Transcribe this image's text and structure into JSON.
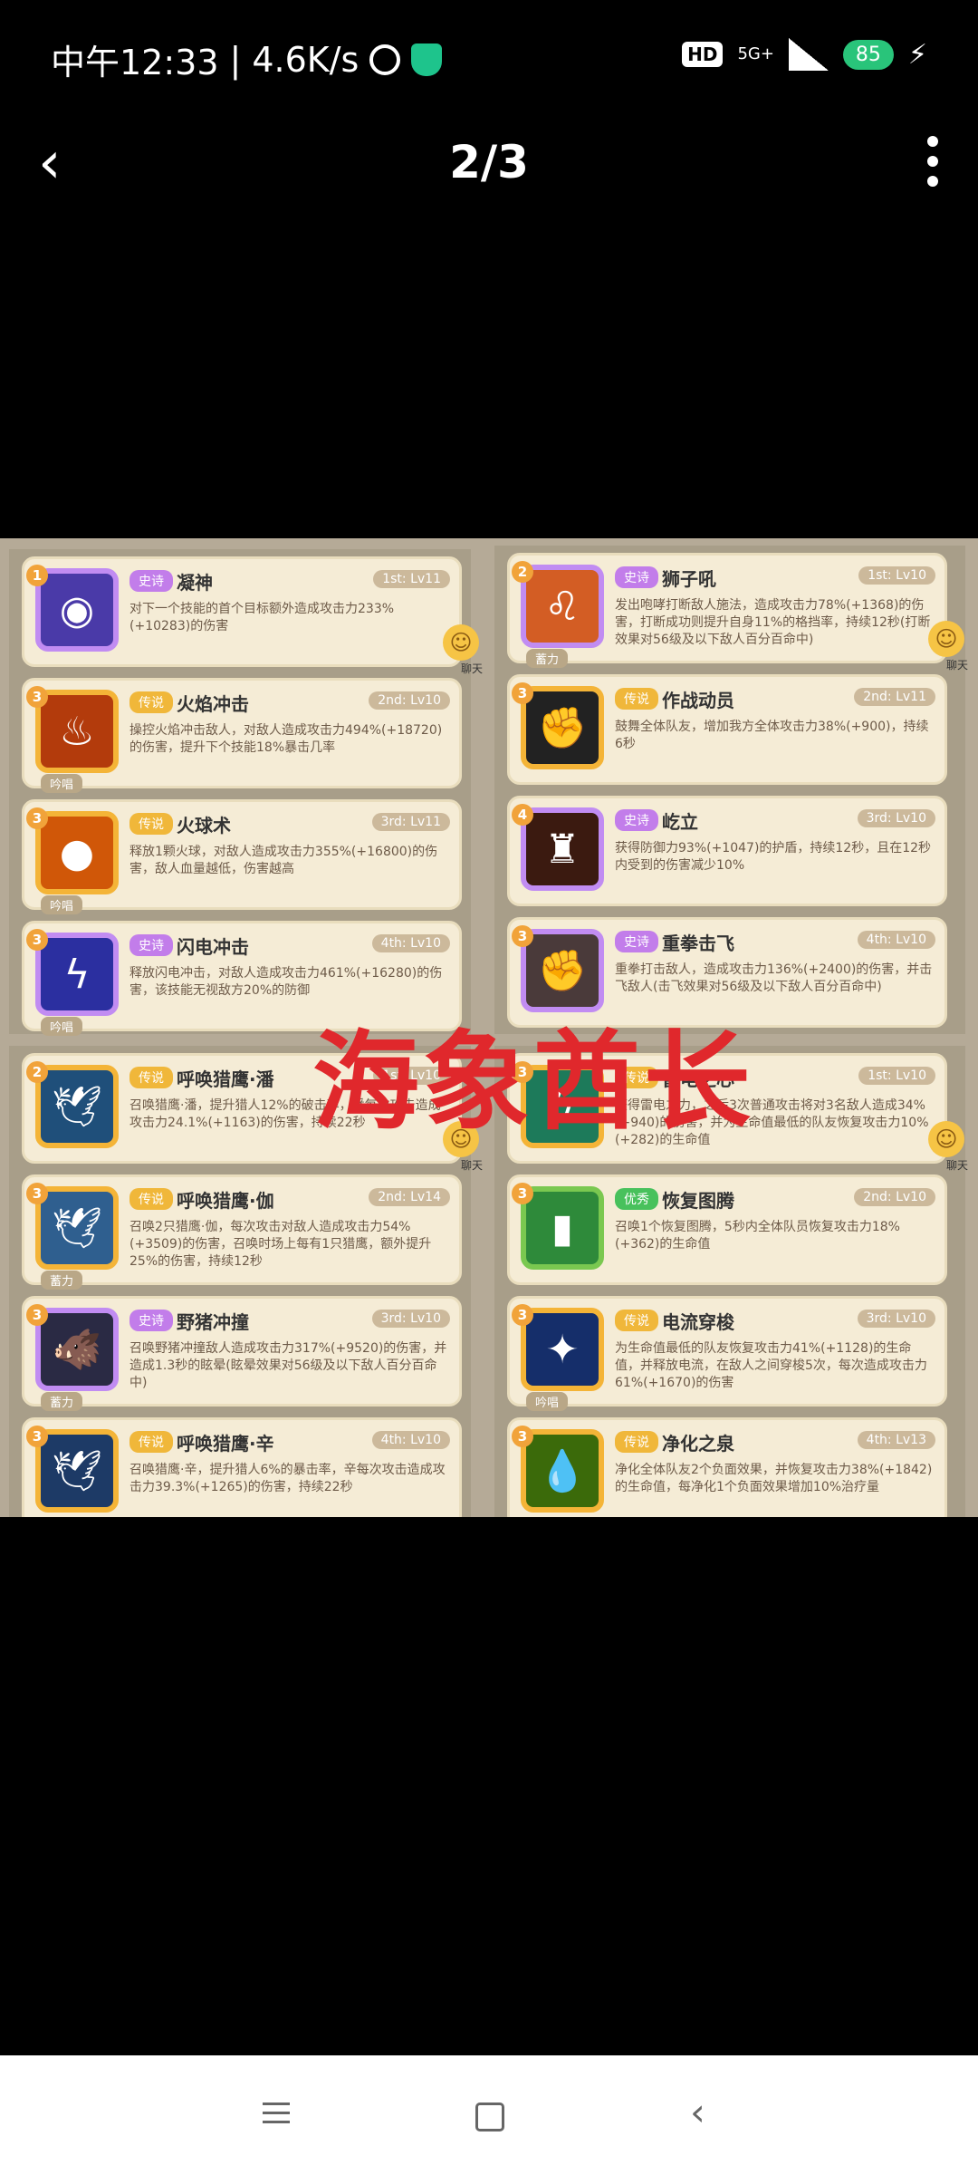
{
  "status_bar": {
    "time": "中午12:33",
    "speed": "4.6K/s",
    "hd": "HD",
    "network": "5G+",
    "battery": "85"
  },
  "header": {
    "counter": "2/3"
  },
  "watermark": "海象酋长",
  "panels": {
    "top_left": [
      {
        "num": "1",
        "rarity": "史诗",
        "rarity_type": "epic",
        "name": "凝神",
        "level": "1st: Lv11",
        "desc": "对下一个技能的首个目标额外造成攻击力233%(+10283)的伤害",
        "tag": "",
        "icon": "eye-icon",
        "chat": "聊天"
      },
      {
        "num": "3",
        "rarity": "传说",
        "rarity_type": "leg",
        "name": "火焰冲击",
        "level": "2nd: Lv10",
        "desc": "操控火焰冲击敌人，对敌人造成攻击力494%(+18720)的伤害，提升下个技能18%暴击几率",
        "tag": "吟唱",
        "icon": "fire-icon"
      },
      {
        "num": "3",
        "rarity": "传说",
        "rarity_type": "leg",
        "name": "火球术",
        "level": "3rd: Lv11",
        "desc": "释放1颗火球，对敌人造成攻击力355%(+16800)的伤害，敌人血量越低，伤害越高",
        "tag": "吟唱",
        "icon": "fireball-icon"
      },
      {
        "num": "3",
        "rarity": "史诗",
        "rarity_type": "epic",
        "name": "闪电冲击",
        "level": "4th: Lv10",
        "desc": "释放闪电冲击，对敌人造成攻击力461%(+16280)的伤害，该技能无视敌方20%的防御",
        "tag": "吟唱",
        "icon": "lightning-icon"
      }
    ],
    "top_right": [
      {
        "num": "2",
        "rarity": "史诗",
        "rarity_type": "epic",
        "name": "狮子吼",
        "level": "1st: Lv10",
        "desc": "发出咆哮打断敌人施法，造成攻击力78%(+1368)的伤害，打断成功则提升自身11%的格挡率，持续12秒(打断效果对56级及以下敌人百分百命中)",
        "tag": "蓄力",
        "icon": "lion-icon",
        "chat": "聊天"
      },
      {
        "num": "3",
        "rarity": "传说",
        "rarity_type": "leg",
        "name": "作战动员",
        "level": "2nd: Lv11",
        "desc": "鼓舞全体队友，增加我方全体攻击力38%(+900)，持续6秒",
        "tag": "",
        "icon": "rally-icon"
      },
      {
        "num": "4",
        "rarity": "史诗",
        "rarity_type": "epic",
        "name": "屹立",
        "level": "3rd: Lv10",
        "desc": "获得防御力93%(+1047)的护盾，持续12秒，且在12秒内受到的伤害减少10%",
        "tag": "",
        "icon": "stand-icon"
      },
      {
        "num": "3",
        "rarity": "史诗",
        "rarity_type": "epic",
        "name": "重拳击飞",
        "level": "4th: Lv10",
        "desc": "重拳打击敌人，造成攻击力136%(+2400)的伤害，并击飞敌人(击飞效果对56级及以下敌人百分百命中)",
        "tag": "",
        "icon": "fist-icon"
      }
    ],
    "bottom_left": [
      {
        "num": "2",
        "rarity": "传说",
        "rarity_type": "leg",
        "name": "呼唤猎鹰·潘",
        "level": "1st: Lv10",
        "desc": "召唤猎鹰·潘，提升猎人12%的破击率，潘每次攻击造成攻击力24.1%(+1163)的伤害，持续22秒",
        "tag": "",
        "icon": "falcon-icon",
        "chat": "聊天"
      },
      {
        "num": "3",
        "rarity": "传说",
        "rarity_type": "leg",
        "name": "呼唤猎鹰·伽",
        "level": "2nd: Lv14",
        "desc": "召唤2只猎鹰·伽，每次攻击对敌人造成攻击力54%(+3509)的伤害，召唤时场上每有1只猎鹰，额外提升25%的伤害，持续12秒",
        "tag": "蓄力",
        "icon": "eagle-icon"
      },
      {
        "num": "3",
        "rarity": "史诗",
        "rarity_type": "epic",
        "name": "野猪冲撞",
        "level": "3rd: Lv10",
        "desc": "召唤野猪冲撞敌人造成攻击力317%(+9520)的伤害，并造成1.3秒的眩晕(眩晕效果对56级及以下敌人百分百命中)",
        "tag": "蓄力",
        "icon": "boar-icon"
      },
      {
        "num": "3",
        "rarity": "传说",
        "rarity_type": "leg",
        "name": "呼唤猎鹰·辛",
        "level": "4th: Lv10",
        "desc": "召唤猎鹰·辛，提升猎人6%的暴击率，辛每次攻击造成攻击力39.3%(+1265)的伤害，持续22秒",
        "tag": "",
        "icon": "hawk-icon"
      }
    ],
    "bottom_right": [
      {
        "num": "3",
        "rarity": "传说",
        "rarity_type": "leg",
        "name": "雷电之心",
        "level": "1st: Lv10",
        "desc": "获得雷电之力，之后3次普通攻击将对3名敌人造成34%(+940)的伤害，并为生命值最低的队友恢复攻击力10%(+282)的生命值",
        "tag": "",
        "icon": "thunder-heart-icon",
        "chat": "聊天"
      },
      {
        "num": "3",
        "rarity": "优秀",
        "rarity_type": "good",
        "name": "恢复图腾",
        "level": "2nd: Lv10",
        "desc": "召唤1个恢复图腾，5秒内全体队员恢复攻击力18%(+362)的生命值",
        "tag": "",
        "icon": "totem-icon"
      },
      {
        "num": "3",
        "rarity": "传说",
        "rarity_type": "leg",
        "name": "电流穿梭",
        "level": "3rd: Lv10",
        "desc": "为生命值最低的队友恢复攻击力41%(+1128)的生命值，并释放电流，在敌人之间穿梭5次，每次造成攻击力61%(+1670)的伤害",
        "tag": "吟唱",
        "icon": "current-icon"
      },
      {
        "num": "3",
        "rarity": "传说",
        "rarity_type": "leg",
        "name": "净化之泉",
        "level": "4th: Lv13",
        "desc": "净化全体队友2个负面效果，并恢复攻击力38%(+1842)的生命值，每净化1个负面效果增加10%治疗量",
        "tag": "",
        "icon": "spring-icon"
      }
    ]
  }
}
